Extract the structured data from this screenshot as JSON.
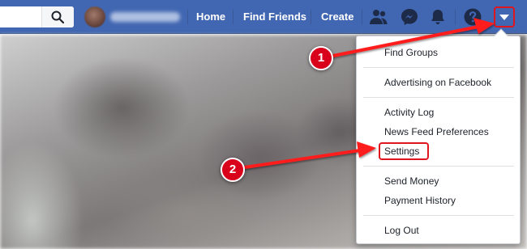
{
  "topbar": {
    "search_icon": "search-icon",
    "nav_links": [
      "Home",
      "Find Friends",
      "Create"
    ],
    "icons": [
      "friends-icon",
      "messenger-icon",
      "notifications-bell-icon",
      "help-question-icon",
      "account-menu-caret-icon"
    ]
  },
  "menu": {
    "find_groups": "Find Groups",
    "advertising": "Advertising on Facebook",
    "activity_log": "Activity Log",
    "news_feed_preferences": "News Feed Preferences",
    "settings": "Settings",
    "send_money": "Send Money",
    "payment_history": "Payment History",
    "log_out": "Log Out"
  },
  "callouts": {
    "step1": "1",
    "step2": "2"
  },
  "colors": {
    "topbar": "#4267b2",
    "highlight": "#e0161f",
    "badge": "#d9001b"
  }
}
